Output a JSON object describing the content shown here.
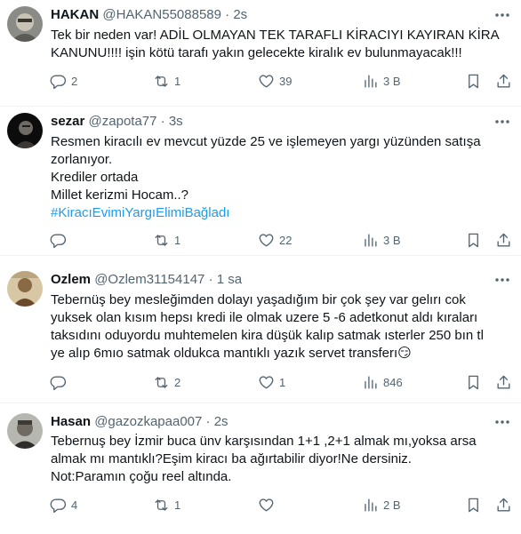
{
  "tweets": [
    {
      "name": "HAKAN",
      "handle": "@HAKAN55088589",
      "time": "2s",
      "lines": [
        "Tek bir neden var! ADİL OLMAYAN TEK TARAFLI KİRACIYI KAYIRAN KİRA",
        "KANUNU!!!! işin kötü tarafı yakın gelecekte kiralık ev bulunmayacak!!!"
      ],
      "hashtag": "",
      "replies": "2",
      "reposts": "1",
      "likes": "39",
      "views": "3 B"
    },
    {
      "name": "sezar",
      "handle": "@zapota77",
      "time": "3s",
      "lines": [
        "Resmen kiracılı ev mevcut yüzde 25 ve işlemeyen yargı yüzünden satışa",
        "zorlanıyor.",
        "Krediler ortada",
        "Millet kerizmi Hocam..?"
      ],
      "hashtag": "#KiracıEvimiYargıElimiBağladı",
      "replies": "",
      "reposts": "1",
      "likes": "22",
      "views": "3 B"
    },
    {
      "name": "Ozlem",
      "handle": "@Ozlem31154147",
      "time": "1 sa",
      "lines": [
        "Tebernüş bey mesleğimden dolayı yaşadığım bir çok şey var gelırı cok",
        "yuksek olan kısım hepsı kredi ile olmak uzere 5 -6 adetkonut aldı kıraları",
        "taksıdını oduyordu muhtemelen kira düşük kalıp satmak ısterler 250 bın tl",
        "ye alıp 6mıo satmak oldukca mantıklı yazık servet transferı😏"
      ],
      "hashtag": "",
      "replies": "",
      "reposts": "2",
      "likes": "1",
      "views": "846"
    },
    {
      "name": "Hasan",
      "handle": "@gazozkapaa007",
      "time": "2s",
      "lines": [
        "Tebernuş bey İzmir buca ünv karşısından 1+1 ,2+1 almak mı,yoksa arsa",
        "almak mı mantıklı?Eşim kiracı ba ağırtabilir diyor!Ne dersiniz.",
        "Not:Paramın çoğu reel altında."
      ],
      "hashtag": "",
      "replies": "4",
      "reposts": "1",
      "likes": "",
      "views": "2 B"
    }
  ],
  "icons": {
    "reply": "reply-icon",
    "repost": "repost-icon",
    "like": "heart-icon",
    "views": "views-icon",
    "bookmark": "bookmark-icon",
    "share": "share-icon",
    "more": "more-icon"
  },
  "colors": {
    "text": "#0f1419",
    "secondary": "#536471",
    "link": "#1d9bf0",
    "divider": "#eff3f4"
  }
}
